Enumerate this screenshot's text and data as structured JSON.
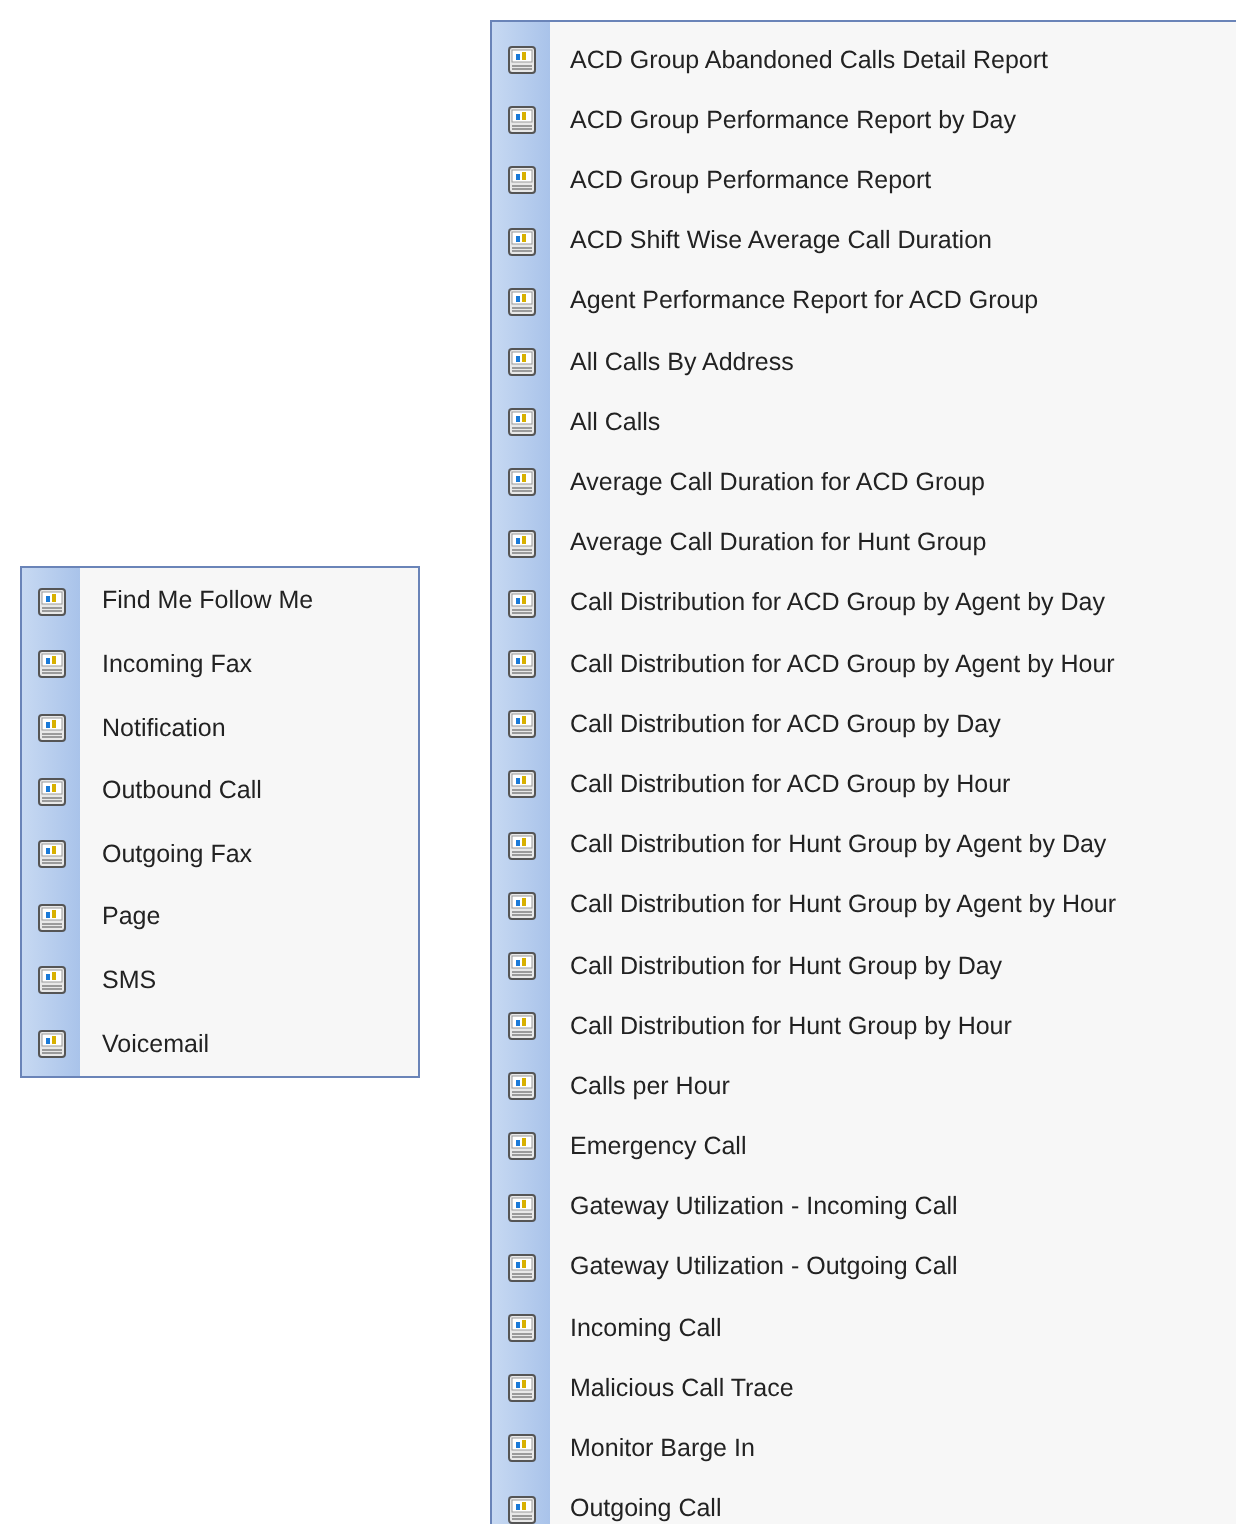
{
  "menus": [
    {
      "items": [
        {
          "label": "Find Me Follow Me"
        },
        {
          "label": "Incoming Fax"
        },
        {
          "label": "Notification"
        },
        {
          "label": "Outbound Call"
        },
        {
          "label": "Outgoing Fax"
        },
        {
          "label": "Page"
        },
        {
          "label": "SMS"
        },
        {
          "label": "Voicemail"
        }
      ]
    },
    {
      "items": [
        {
          "label": "ACD Group Abandoned Calls Detail Report"
        },
        {
          "label": "ACD Group Performance Report by Day"
        },
        {
          "label": "ACD Group Performance Report"
        },
        {
          "label": "ACD Shift Wise Average Call Duration"
        },
        {
          "label": "Agent Performance Report for ACD Group"
        },
        {
          "label": "All Calls By Address"
        },
        {
          "label": "All Calls"
        },
        {
          "label": "Average Call Duration for ACD Group"
        },
        {
          "label": "Average Call Duration for Hunt Group"
        },
        {
          "label": "Call Distribution for ACD Group by Agent by Day"
        },
        {
          "label": "Call Distribution for ACD Group by Agent by Hour"
        },
        {
          "label": "Call Distribution for ACD Group by Day"
        },
        {
          "label": "Call Distribution for ACD Group by Hour"
        },
        {
          "label": "Call Distribution for Hunt Group by Agent by Day"
        },
        {
          "label": "Call Distribution for Hunt Group by Agent by Hour"
        },
        {
          "label": "Call Distribution for Hunt Group by Day"
        },
        {
          "label": "Call Distribution for Hunt Group by Hour"
        },
        {
          "label": "Calls per Hour"
        },
        {
          "label": "Emergency Call"
        },
        {
          "label": "Gateway Utilization - Incoming Call"
        },
        {
          "label": "Gateway Utilization - Outgoing Call"
        },
        {
          "label": "Incoming Call"
        },
        {
          "label": "Malicious Call Trace"
        },
        {
          "label": "Monitor Barge In"
        },
        {
          "label": "Outgoing Call"
        }
      ]
    }
  ]
}
